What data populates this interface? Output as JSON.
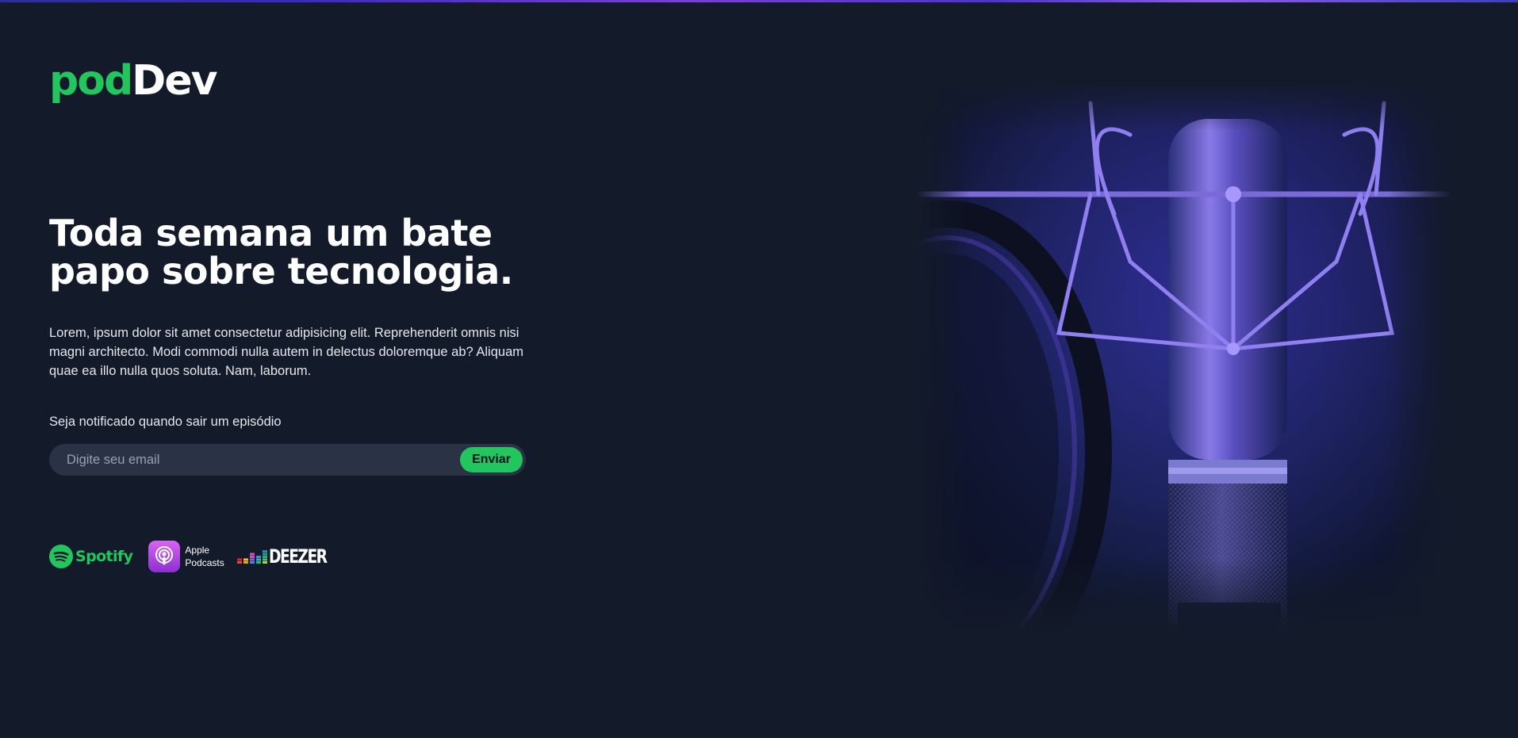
{
  "brand": {
    "pod": "pod",
    "dev": "Dev",
    "pod_color": "#22c55e",
    "dev_color": "#ffffff"
  },
  "hero": {
    "headline": "Toda semana um bate papo sobre tecnologia.",
    "description": "Lorem, ipsum dolor sit amet consectetur adipisicing elit. Reprehenderit omnis nisi magni architecto. Modi commodi nulla autem in delectus doloremque ab? Aliquam quae ea illo nulla quos soluta. Nam, laborum."
  },
  "subscribe": {
    "label": "Seja notificado quando sair um episódio",
    "email_placeholder": "Digite seu email",
    "email_value": "",
    "button_label": "Enviar",
    "button_color": "#22c55e"
  },
  "platforms": {
    "spotify": {
      "label": "Spotify",
      "icon": "spotify-icon",
      "color": "#22c55e"
    },
    "apple": {
      "line1": "Apple",
      "line2": "Podcasts",
      "icon": "apple-podcasts-icon"
    },
    "deezer": {
      "label": "DEEZER",
      "icon": "deezer-icon"
    }
  },
  "colors": {
    "background": "#131a29",
    "input_background": "#2a3246",
    "accent": "#22c55e"
  },
  "image": {
    "subject": "studio-microphone-photo"
  }
}
